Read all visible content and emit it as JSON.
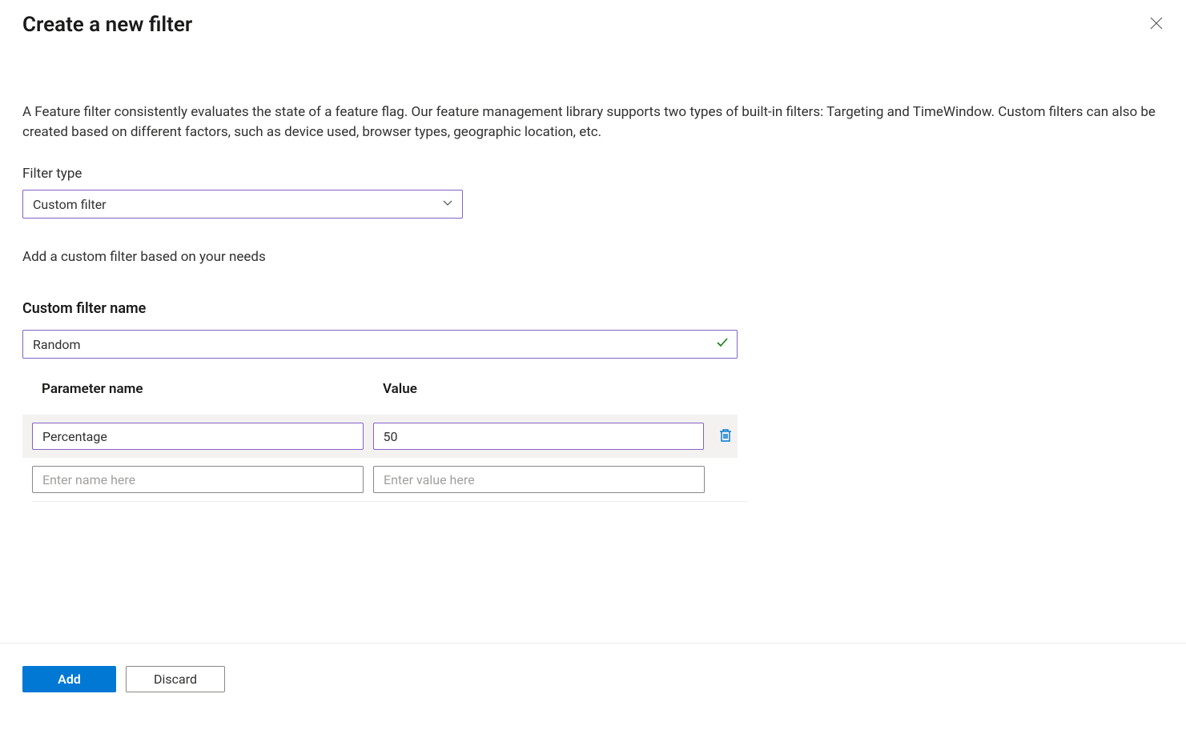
{
  "header": {
    "title": "Create a new filter"
  },
  "description": "A Feature filter consistently evaluates the state of a feature flag. Our feature management library supports two types of built-in filters: Targeting and TimeWindow. Custom filters can also be created based on different factors, such as device used, browser types, geographic location, etc.",
  "filterType": {
    "label": "Filter type",
    "selected": "Custom filter"
  },
  "helpText": "Add a custom filter based on your needs",
  "customFilterName": {
    "label": "Custom filter name",
    "value": "Random"
  },
  "paramsTable": {
    "headers": {
      "name": "Parameter name",
      "value": "Value"
    },
    "rows": [
      {
        "name": "Percentage",
        "value": "50"
      }
    ],
    "newRow": {
      "namePlaceholder": "Enter name here",
      "valuePlaceholder": "Enter value here"
    }
  },
  "footer": {
    "add": "Add",
    "discard": "Discard"
  }
}
